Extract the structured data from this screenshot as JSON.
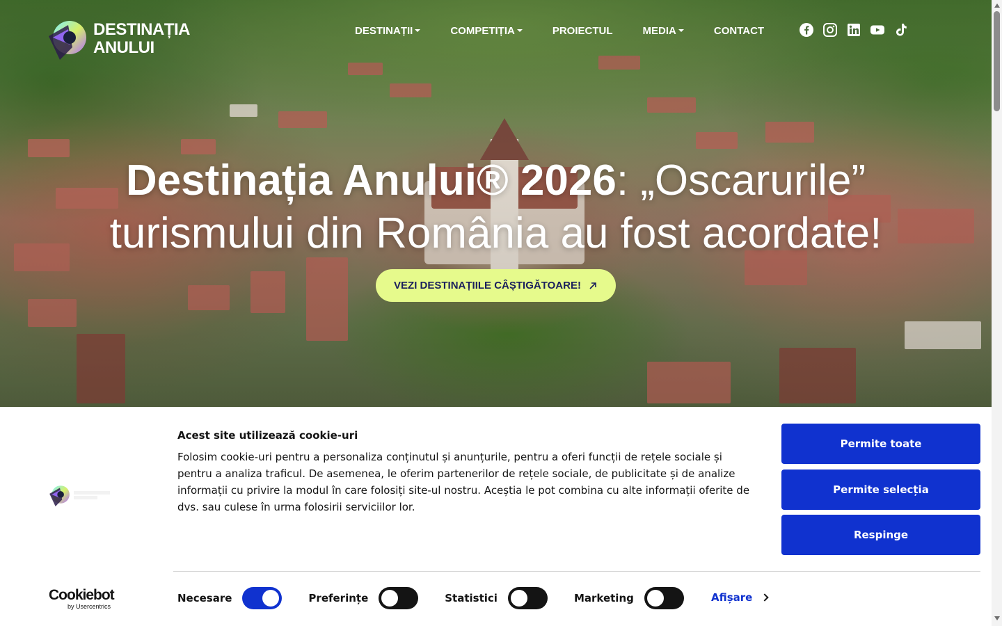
{
  "brand": {
    "line1": "DESTINAȚIA",
    "line2": "ANULUI"
  },
  "nav": {
    "items": [
      {
        "label": "DESTINAȚII",
        "dropdown": true
      },
      {
        "label": "COMPETIȚIA",
        "dropdown": true
      },
      {
        "label": "PROIECTUL",
        "dropdown": false
      },
      {
        "label": "MEDIA",
        "dropdown": true
      },
      {
        "label": "CONTACT",
        "dropdown": false
      }
    ],
    "socials": [
      "facebook-icon",
      "instagram-icon",
      "linkedin-icon",
      "youtube-icon",
      "tiktok-icon"
    ]
  },
  "hero": {
    "headline_bold": "Destinația Anului® 2026",
    "headline_light_1": ": „Oscarurile”",
    "headline_light_2": "turismului din România au fost acordate!",
    "cta_label": "VEZI DESTINAȚIILE CÂȘTIGĂTOARE!",
    "cta_icon": "arrow-up-right-icon"
  },
  "cookie": {
    "title": "Acest site utilizează cookie-uri",
    "text": "Folosim cookie-uri pentru a personaliza conținutul și anunțurile, pentru a oferi funcții de rețele sociale și pentru a analiza traficul. De asemenea, le oferim partenerilor de rețele sociale, de publicitate și de analize informații cu privire la modul în care folosiți site-ul nostru. Aceștia le pot combina cu alte informații oferite de dvs. sau culese în urma folosirii serviciilor lor.",
    "buttons": {
      "allow_all": "Permite toate",
      "allow_selection": "Permite selecția",
      "deny": "Respinge"
    },
    "toggles": [
      {
        "label": "Necesare",
        "on": true
      },
      {
        "label": "Preferințe",
        "on": false
      },
      {
        "label": "Statistici",
        "on": false
      },
      {
        "label": "Marketing",
        "on": false
      }
    ],
    "details_label": "Afișare",
    "cookiebot": {
      "name": "Cookiebot",
      "by": "by Usercentrics"
    }
  },
  "colors": {
    "primary_blue": "#1032cf",
    "cta_lime": "#e6fa8c",
    "cta_text": "#1a1f5c"
  }
}
